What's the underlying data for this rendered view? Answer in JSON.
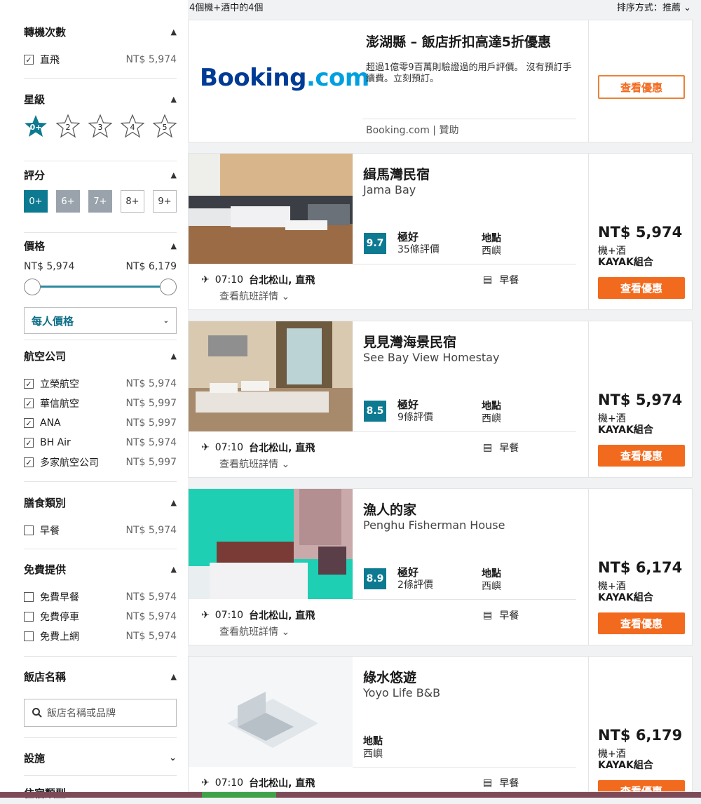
{
  "topbar": {
    "result_count": "4個機+酒中的4個",
    "sort_label": "排序方式：",
    "sort_value": "推薦",
    "sort_icon": "chevron-down-icon"
  },
  "sidebar": {
    "stops": {
      "title": "轉機次數",
      "items": [
        {
          "label": "直飛",
          "price": "NT$ 5,974",
          "checked": true
        }
      ]
    },
    "stars": {
      "title": "星級",
      "items": [
        "0+",
        "2",
        "3",
        "4",
        "5"
      ],
      "selected": "0+",
      "accent": "#0d7a91"
    },
    "score": {
      "title": "評分",
      "items": [
        "0+",
        "6+",
        "7+",
        "8+",
        "9+"
      ],
      "selected": "0+"
    },
    "price": {
      "title": "價格",
      "min": "NT$ 5,974",
      "max": "NT$ 6,179",
      "mode": "每人價格"
    },
    "airlines": {
      "title": "航空公司",
      "items": [
        {
          "label": "立榮航空",
          "price": "NT$ 5,974",
          "checked": true
        },
        {
          "label": "華信航空",
          "price": "NT$ 5,997",
          "checked": true
        },
        {
          "label": "ANA",
          "price": "NT$ 5,997",
          "checked": true
        },
        {
          "label": "BH Air",
          "price": "NT$ 5,974",
          "checked": true
        },
        {
          "label": "多家航空公司",
          "price": "NT$ 5,997",
          "checked": true
        }
      ]
    },
    "meals": {
      "title": "膳食類別",
      "items": [
        {
          "label": "早餐",
          "price": "NT$ 5,974",
          "checked": false
        }
      ]
    },
    "free": {
      "title": "免費提供",
      "items": [
        {
          "label": "免費早餐",
          "price": "NT$ 5,974",
          "checked": false
        },
        {
          "label": "免費停車",
          "price": "NT$ 5,974",
          "checked": false
        },
        {
          "label": "免費上網",
          "price": "NT$ 5,974",
          "checked": false
        }
      ]
    },
    "hotel_name": {
      "title": "飯店名稱",
      "placeholder": "飯店名稱或品牌"
    },
    "facilities": {
      "title": "設施"
    },
    "lodging": {
      "title": "住宿類型"
    }
  },
  "ad": {
    "logo_main": "Booking",
    "logo_tld": ".com",
    "title": "澎湖縣 – 飯店折扣高達5折優惠",
    "desc": "超過1億零9百萬則驗證過的用戶評價。 沒有預訂手續費。立刻預訂。",
    "footer": "Booking.com | 贊助",
    "button": "查看優惠",
    "brand_color": "#003b95"
  },
  "results": [
    {
      "name": "緝馬灣民宿",
      "ename": "Jama Bay",
      "score": "9.7",
      "rating": "極好",
      "reviews": "35條評價",
      "loc_label": "地點",
      "loc": "西嶼",
      "flight_time": "07:10",
      "flight_route": "台北松山, 直飛",
      "details": "查看航班詳情",
      "meal": "早餐",
      "price": "NT$ 5,974",
      "pkg1": "機+酒",
      "pkg2": "KAYAK組合",
      "cta": "查看優惠"
    },
    {
      "name": "見見灣海景民宿",
      "ename": "See Bay View Homestay",
      "score": "8.5",
      "rating": "極好",
      "reviews": "9條評價",
      "loc_label": "地點",
      "loc": "西嶼",
      "flight_time": "07:10",
      "flight_route": "台北松山, 直飛",
      "details": "查看航班詳情",
      "meal": "早餐",
      "price": "NT$ 5,974",
      "pkg1": "機+酒",
      "pkg2": "KAYAK組合",
      "cta": "查看優惠"
    },
    {
      "name": "漁人的家",
      "ename": "Penghu Fisherman House",
      "score": "8.9",
      "rating": "極好",
      "reviews": "2條評價",
      "loc_label": "地點",
      "loc": "西嶼",
      "flight_time": "07:10",
      "flight_route": "台北松山, 直飛",
      "details": "查看航班詳情",
      "meal": "早餐",
      "price": "NT$ 6,174",
      "pkg1": "機+酒",
      "pkg2": "KAYAK組合",
      "cta": "查看優惠"
    },
    {
      "name": "綠水悠遊",
      "ename": "Yoyo Life B&B",
      "loc_label": "地點",
      "loc": "西嶼",
      "flight_time": "07:10",
      "flight_route": "台北松山, 直飛",
      "meal": "早餐",
      "price": "NT$ 6,179",
      "pkg1": "機+酒",
      "pkg2": "KAYAK組合",
      "cta": "查看優惠"
    }
  ],
  "colors": {
    "accent": "#0d7a91",
    "cta": "#f26a1e"
  }
}
